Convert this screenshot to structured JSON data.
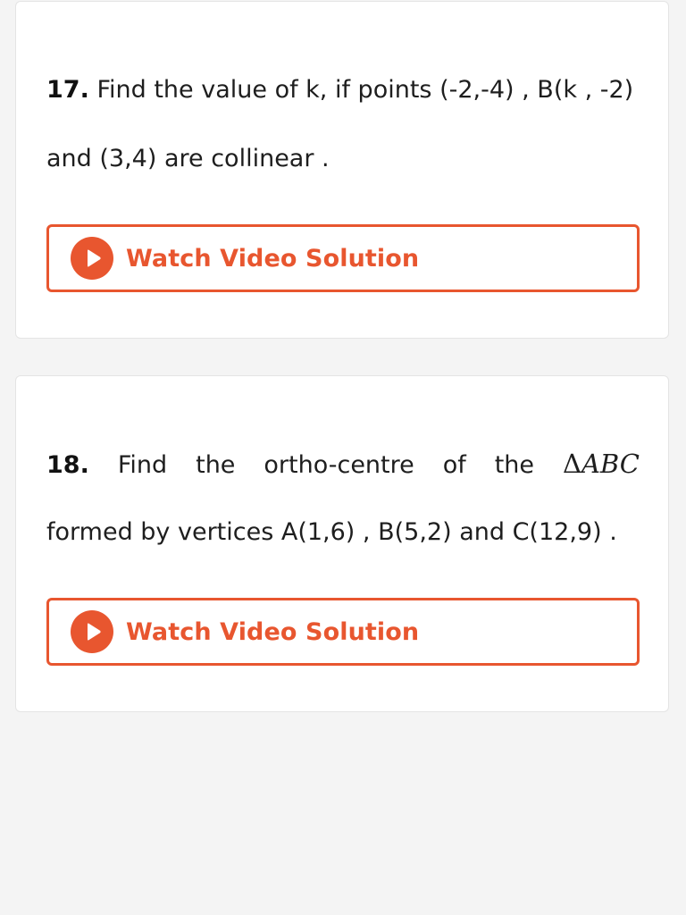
{
  "questions": [
    {
      "number": "17.",
      "line1": "Find the value of k, if points (-2,-4) , B(k , -2)",
      "line2": "and (3,4) are collinear .",
      "button_label": "Watch Video Solution"
    },
    {
      "number": "18.",
      "line1_words": [
        "Find",
        "the",
        "ortho-centre",
        "of",
        "the"
      ],
      "math": {
        "delta": "Δ",
        "var": "ABC"
      },
      "line2": "formed by vertices A(1,6) , B(5,2) and C(12,9) .",
      "button_label": "Watch Video Solution"
    }
  ],
  "colors": {
    "accent": "#e8562f",
    "background": "#f4f4f4",
    "card": "#ffffff",
    "text": "#1e1e1e"
  },
  "icons": {
    "button_icon": "play-circle-icon"
  }
}
